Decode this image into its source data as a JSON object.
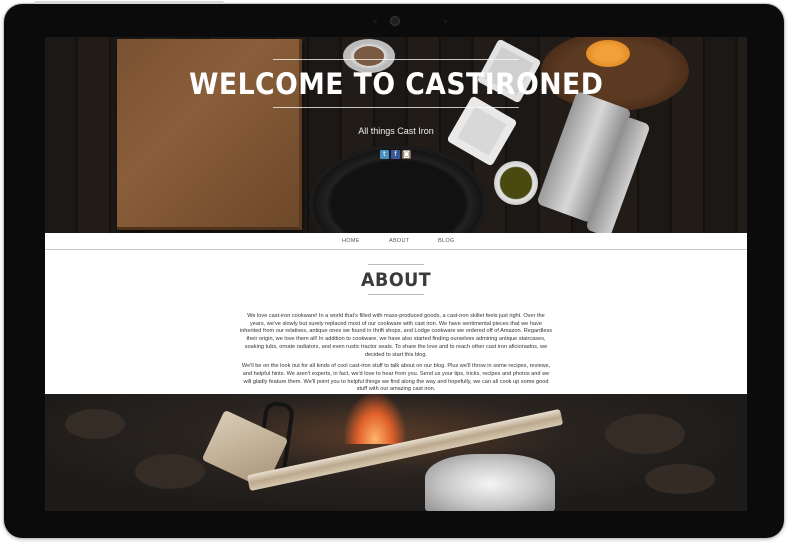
{
  "hero": {
    "title": "WELCOME TO CASTIRONED",
    "subtitle": "All things Cast Iron",
    "social_icons": [
      {
        "name": "twitter-icon",
        "glyph": "t",
        "color": "#4a8fbf"
      },
      {
        "name": "facebook-icon",
        "glyph": "f",
        "color": "#3b5998"
      },
      {
        "name": "instagram-icon",
        "glyph": "◙",
        "color": "#7c6a58"
      }
    ]
  },
  "nav": {
    "items": [
      {
        "label": "HOME"
      },
      {
        "label": "ABOUT"
      },
      {
        "label": "BLOG"
      }
    ]
  },
  "about": {
    "title": "ABOUT",
    "paragraphs": [
      "We love cast-iron cookware! In a world that's filled with mass-produced goods, a cast-iron skillet feels just right. Over the years, we've slowly but surely replaced most of our cookware with cast iron. We have sentimental pieces that we have inherited from our relatives, antique ones we found in thrift shops, and Lodge cookware we ordered off of Amazon. Regardless their origin, we love them all! In addition to cookware, we have also started finding ourselves admiring antique staircases, soaking tubs, ornate radiators, and even rustic tractor seats. To share the love and to reach other cast iron aficionados, we decided to start this blog.",
      "We'll be on the look out for all kinds of cool cast-iron stuff to talk about on our blog. Plus we'll throw in some recipes, reviews, and helpful hints. We aren't experts, in fact, we'd love to hear from you. Send us your tips, tricks, recipes and photos and we will gladly feature them. We'll point you to helpful things we find along the way and hopefully, we can all cook up some good stuff with our amazing cast iron."
    ]
  }
}
